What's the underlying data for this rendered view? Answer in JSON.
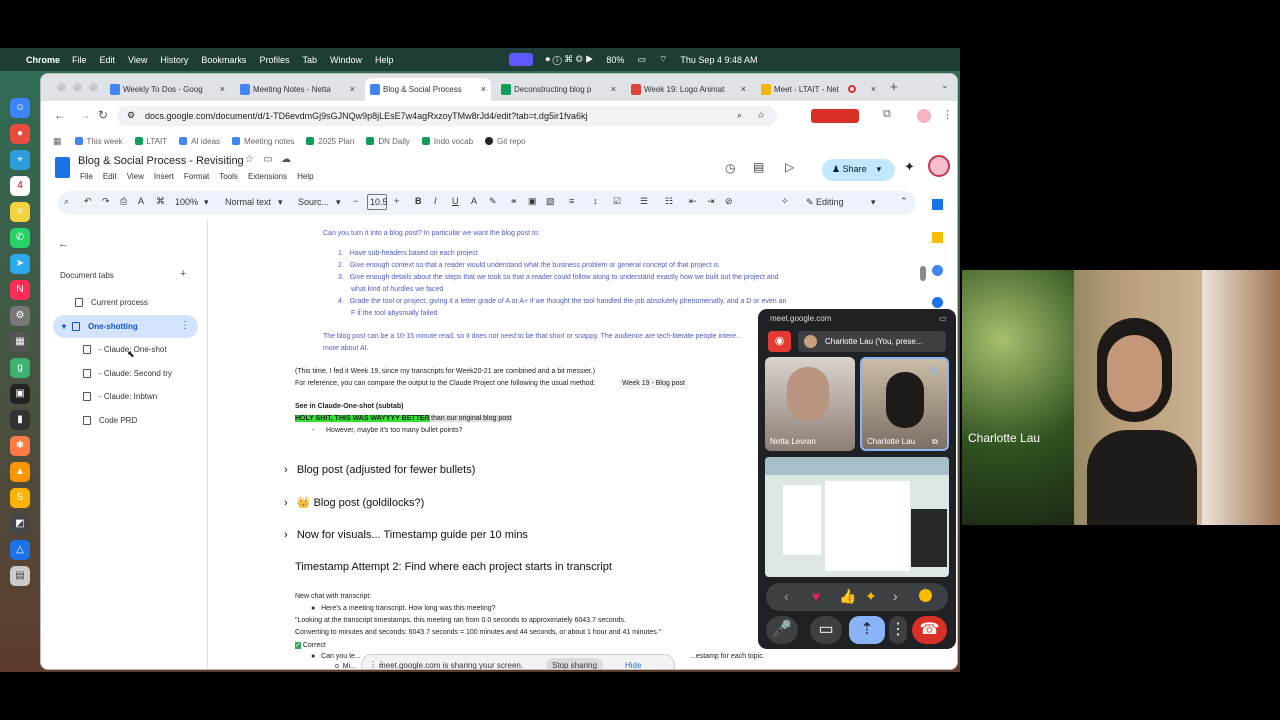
{
  "menubar": {
    "app": "Chrome",
    "items": [
      "File",
      "Edit",
      "View",
      "History",
      "Bookmarks",
      "Profiles",
      "Tab",
      "Window",
      "Help"
    ],
    "battery": "80%",
    "datetime": "Thu Sep 4  9:48 AM"
  },
  "tabs": [
    {
      "title": "Weekly To Dos - Goog",
      "color": "#4285f4"
    },
    {
      "title": "Meeting Notes - Netta",
      "color": "#4285f4"
    },
    {
      "title": "Blog & Social Process",
      "color": "#4285f4"
    },
    {
      "title": "Deconstructing blog p",
      "color": "#0f9d58"
    },
    {
      "title": "Week 19: Logo Animat",
      "color": "#db4437"
    },
    {
      "title": "Meet - LTAIT - Net",
      "color": "#f4b400"
    }
  ],
  "address": {
    "url": "docs.google.com/document/d/1-TD6evdmGj9sGJNQw9p8jLEsE7w4agRxzoyTMw8rJd4/edit?tab=t.dg5ir1fva6kj"
  },
  "bookmarks": [
    "This week",
    "LTAIT",
    "AI ideas",
    "Meeting notes",
    "2025 Plan",
    "DN Daily",
    "Indo vocab",
    "Git repo"
  ],
  "docs": {
    "title": "Blog & Social Process - Revisiting",
    "menus": [
      "File",
      "Edit",
      "View",
      "Insert",
      "Format",
      "Tools",
      "Extensions",
      "Help"
    ],
    "share": "Share",
    "zoom": "100%",
    "style": "Normal text",
    "font": "Sourc...",
    "fontsize": "10.5",
    "mode": "Editing"
  },
  "sidebar": {
    "heading": "Document tabs",
    "items": [
      "Current process",
      "One-shotting",
      "- Claude: One-shot",
      "- Claude: Second try",
      "- Claude: Inbtwn",
      "Code PRD"
    ]
  },
  "document": {
    "intro": "Can you turn it into a blog post? In particular we want the blog post to:",
    "list": [
      "Have sub-headers based on each project",
      "Give enough context so that a reader would understand what the business problem or general concept of that project is",
      "Give enough details about the steps that we took so that a reader could follow along to understand exactly how we built out the project and",
      "what kind of hurdles we faced",
      "Grade the tool or project, giving it a letter grade of A or A+ if we thought the tool handled the job absolutely phenomenally, and a D or even an",
      "F if the tool abysmally failed"
    ],
    "p1": "The blog post can be a 10-15 minute read, so it does not need to be that short or snappy. The audience are tech-literate people intere...",
    "p2": "more about AI.",
    "p3": "(This time, I fed it Week 19, since my transcripts for Week20-21 are combined and a bit messier.)",
    "p4": "For reference, you can compare the output to the Claude Project one following the usual method:",
    "chip": "Week 19 - Blog post",
    "see": "See in Claude-One-shot (subtab)",
    "highlight": "HOLY SHIT, THIS WAS WAYYYY BETTER",
    "after_highlight": " than our original blog post",
    "bullet": "However, maybe it's too many bullet points?",
    "section1": "Blog post (adjusted for fewer bullets)",
    "section2": "Blog post (goldilocks?)",
    "section3": "Now for visuals... Timestamp guide per 10 mins",
    "heading": "Timestamp Attempt 2: Find where each project starts in transcript",
    "newchat": "New chat with transcript:",
    "q1": "Here's a meeting transcript. How long was this meeting?",
    "a1": "\"Looking at the transcript timestamps, this meeting ran from 0.0 seconds to approximately 6043.7 seconds.",
    "a2": "Converting to minutes and seconds: 6043.7 seconds = 100 minutes and 44 seconds, or about 1 hour and 41 minutes.\"",
    "correct": "Correct",
    "q2": "Can you te...",
    "q2end": "...estamp for each topic.",
    "cut": "Mi..."
  },
  "meet": {
    "url": "meet.google.com",
    "presenter": "Charlotte Lau (You, prese...",
    "participants": [
      "Netta Levran",
      "Charlotte Lau"
    ],
    "share_message": "meet.google.com is sharing your screen.",
    "stop": "Stop sharing",
    "hide": "Hide"
  },
  "camera": {
    "name": "Charlotte Lau"
  }
}
